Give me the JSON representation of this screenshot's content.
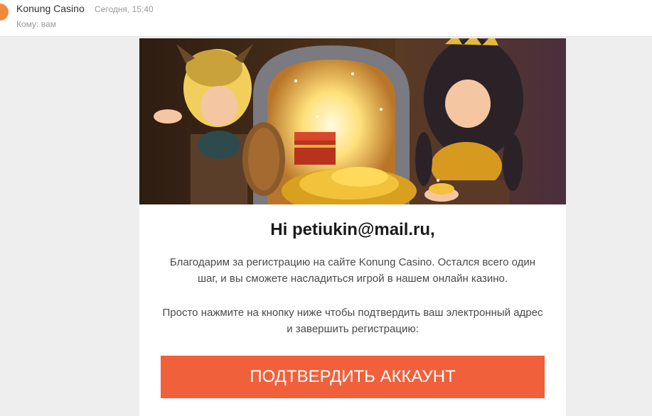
{
  "mail": {
    "sender": "Konung Casino",
    "date": "Сегодня, 15:40",
    "recipient": "Кому: вам"
  },
  "email": {
    "greeting": "Hi petiukin@mail.ru,",
    "paragraph_1": "Благодарим за регистрацию на сайте Konung Casino. Остался всего один шаг, и вы сможете насладиться игрой в нашем онлайн казино.",
    "paragraph_2": "Просто нажмите на кнопку ниже чтобы подтвердить ваш электронный адрес и завершить регистрацию:",
    "confirm_button": "ПОДТВЕРДИТЬ АККАУНТ"
  },
  "colors": {
    "accent": "#f0603a",
    "avatar": "#f18a3c",
    "background": "#eeeeee"
  },
  "icons": {
    "avatar": "sender-avatar"
  }
}
